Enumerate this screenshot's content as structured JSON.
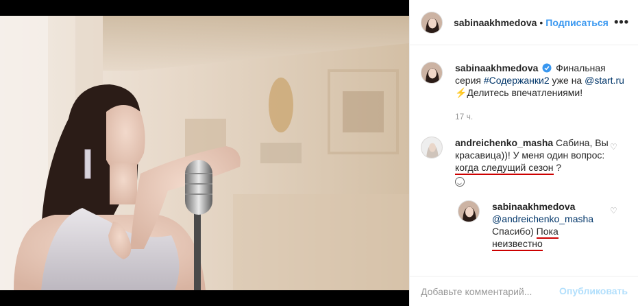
{
  "post": {
    "username": "sabinaakhmedova",
    "separator": "•",
    "subscribe_label": "Подписаться",
    "more_label": "•••"
  },
  "caption": {
    "username": "sabinaakhmedova",
    "text_before": "Финальная серия ",
    "hashtag": "#Содержанки2",
    "text_middle": " уже на ",
    "mention": "@start.ru",
    "text_after": " ⚡Делитесь впечатлениями!",
    "time": "17 ч."
  },
  "comments": [
    {
      "username": "andreichenko_masha",
      "text_before": " Сабина, Вы красавица))! У меня один вопрос: ",
      "highlight": "когда следущий сезон",
      "text_after": " ?"
    },
    {
      "username": "sabinaakhmedova",
      "mention": "@andreichenko_masha",
      "text_before": " Спасибо) ",
      "highlight1": "Пока",
      "highlight2": "неизвестно"
    }
  ],
  "add_comment": {
    "placeholder": "Добавьте комментарий...",
    "publish_label": "Опубликовать"
  },
  "icons": {
    "heart": "heart-icon",
    "verified": "verified-badge-icon",
    "emoji": "grinning-face-icon",
    "avatar": "user-avatar"
  },
  "colors": {
    "link": "#003569",
    "subscribe": "#3897f0",
    "publish_disabled": "#b2dffc",
    "verified": "#3897f0",
    "underline": "#cc0000"
  }
}
